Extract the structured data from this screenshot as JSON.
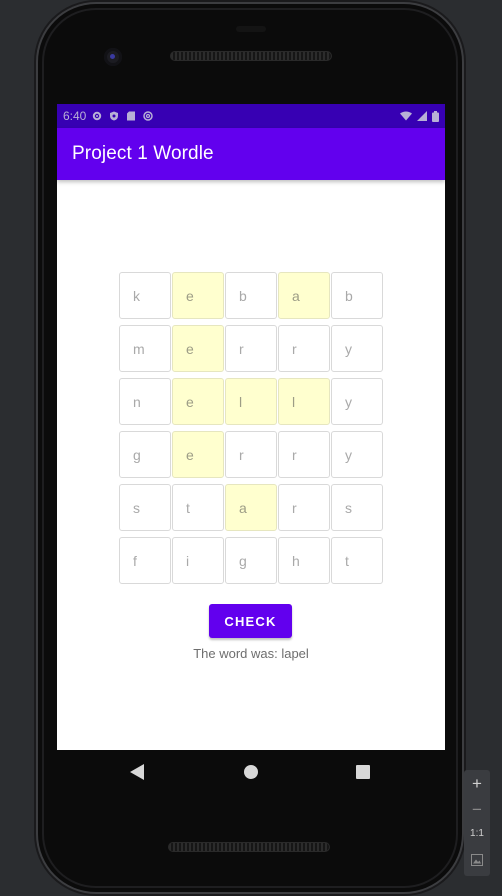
{
  "status_bar": {
    "time": "6:40",
    "left_icons": [
      "settings-icon",
      "shield-icon",
      "sd-card-icon",
      "at-icon"
    ],
    "right_icons": [
      "wifi-icon",
      "signal-icon",
      "battery-icon"
    ]
  },
  "app": {
    "title": "Project 1 Wordle",
    "theme": {
      "primary": "#6200ee",
      "primary_dark": "#3700b3",
      "hint": "#ffffcf"
    }
  },
  "grid": {
    "rows": [
      [
        {
          "letter": "k",
          "hint": false
        },
        {
          "letter": "e",
          "hint": true
        },
        {
          "letter": "b",
          "hint": false
        },
        {
          "letter": "a",
          "hint": true
        },
        {
          "letter": "b",
          "hint": false
        }
      ],
      [
        {
          "letter": "m",
          "hint": false
        },
        {
          "letter": "e",
          "hint": true
        },
        {
          "letter": "r",
          "hint": false
        },
        {
          "letter": "r",
          "hint": false
        },
        {
          "letter": "y",
          "hint": false
        }
      ],
      [
        {
          "letter": "n",
          "hint": false
        },
        {
          "letter": "e",
          "hint": true
        },
        {
          "letter": "l",
          "hint": true
        },
        {
          "letter": "l",
          "hint": true
        },
        {
          "letter": "y",
          "hint": false
        }
      ],
      [
        {
          "letter": "g",
          "hint": false
        },
        {
          "letter": "e",
          "hint": true
        },
        {
          "letter": "r",
          "hint": false
        },
        {
          "letter": "r",
          "hint": false
        },
        {
          "letter": "y",
          "hint": false
        }
      ],
      [
        {
          "letter": "s",
          "hint": false
        },
        {
          "letter": "t",
          "hint": false
        },
        {
          "letter": "a",
          "hint": true
        },
        {
          "letter": "r",
          "hint": false
        },
        {
          "letter": "s",
          "hint": false
        }
      ],
      [
        {
          "letter": "f",
          "hint": false
        },
        {
          "letter": "i",
          "hint": false
        },
        {
          "letter": "g",
          "hint": false
        },
        {
          "letter": "h",
          "hint": false
        },
        {
          "letter": "t",
          "hint": false
        }
      ]
    ]
  },
  "actions": {
    "check_label": "CHECK"
  },
  "result": {
    "message": "The word was: lapel"
  },
  "nav": {
    "icons": [
      "back-icon",
      "home-icon",
      "recents-icon"
    ]
  },
  "emulator": {
    "zoom_in": "+",
    "zoom_out": "−",
    "one_to_one": "1:1"
  }
}
